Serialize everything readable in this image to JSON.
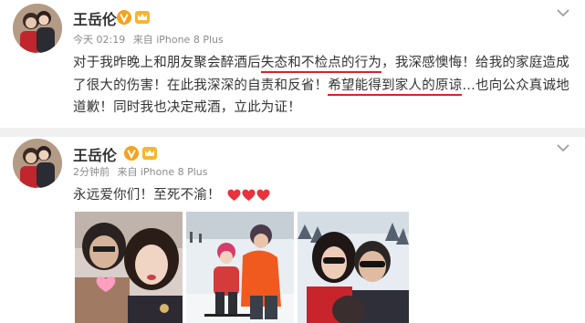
{
  "post1": {
    "username": "王岳伦",
    "time": "今天 02:19",
    "source": "来自 iPhone 8 Plus",
    "text_before": "对于我昨晚上和朋友聚会醉酒后",
    "text_underline1": "失态和不检点的行为",
    "text_middle": "，我深感懊悔！给我的家庭造成了很大的伤害！在此我深深的自责和反省！",
    "text_underline2": "希望能得到家人的原谅",
    "text_after": "…也向公众真诚地道歉！同时我也决定戒酒，立此为证！",
    "icons": [
      "vip-icon",
      "crown-icon",
      "chevron-down-icon"
    ]
  },
  "post2": {
    "username": "王岳伦",
    "time": "2分钟前",
    "source": "来自 iPhone 8 Plus",
    "text": "永远爱你们！至死不渝！",
    "hearts": 3,
    "icons": [
      "vip-icon",
      "crown-icon",
      "chevron-down-icon",
      "heart-icon"
    ]
  },
  "colors": {
    "underline": "#d9222a",
    "vip": "#f6a21c",
    "heart": "#e8323c",
    "meta": "#8a8a8a",
    "separator": "#f0f0f0"
  }
}
